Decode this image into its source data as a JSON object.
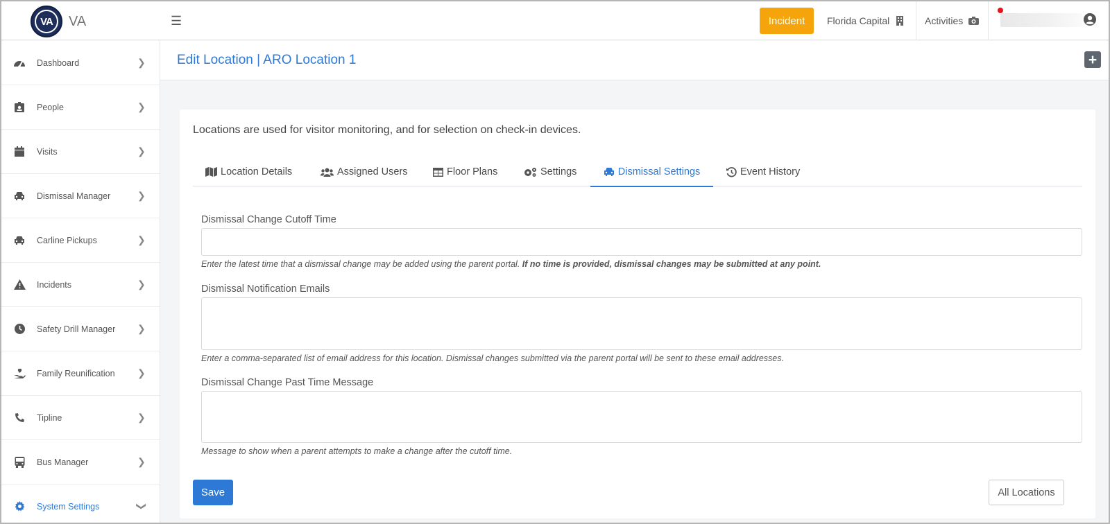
{
  "app": {
    "logo_text": "VA",
    "logo_initials": "VA"
  },
  "topbar": {
    "incident_label": "Incident",
    "location_label": "Florida Capital",
    "activities_label": "Activities"
  },
  "sidebar": {
    "items": [
      {
        "label": "Dashboard",
        "icon": "gauge-icon"
      },
      {
        "label": "People",
        "icon": "id-badge-icon"
      },
      {
        "label": "Visits",
        "icon": "calendar-icon"
      },
      {
        "label": "Dismissal Manager",
        "icon": "car-icon"
      },
      {
        "label": "Carline Pickups",
        "icon": "car-icon"
      },
      {
        "label": "Incidents",
        "icon": "warning-icon"
      },
      {
        "label": "Safety Drill Manager",
        "icon": "clock-icon"
      },
      {
        "label": "Family Reunification",
        "icon": "hand-heart-icon"
      },
      {
        "label": "Tipline",
        "icon": "phone-icon"
      },
      {
        "label": "Bus Manager",
        "icon": "bus-icon"
      },
      {
        "label": "System Settings",
        "icon": "gear-icon",
        "active": true
      }
    ]
  },
  "page": {
    "title": "Edit Location | ARO Location 1",
    "intro": "Locations are used for visitor monitoring, and for selection on check-in devices."
  },
  "tabs": [
    {
      "label": "Location Details",
      "icon": "map-icon"
    },
    {
      "label": "Assigned Users",
      "icon": "users-icon"
    },
    {
      "label": "Floor Plans",
      "icon": "table-icon"
    },
    {
      "label": "Settings",
      "icon": "gears-icon"
    },
    {
      "label": "Dismissal Settings",
      "icon": "car-icon",
      "active": true
    },
    {
      "label": "Event History",
      "icon": "history-icon"
    }
  ],
  "form": {
    "cutoff": {
      "label": "Dismissal Change Cutoff Time",
      "value": "",
      "help": "Enter the latest time that a dismissal change may be added using the parent portal.",
      "help_bold": "If no time is provided, dismissal changes may be submitted at any point."
    },
    "emails": {
      "label": "Dismissal Notification Emails",
      "value": "",
      "help": "Enter a comma-separated list of email address for this location. Dismissal changes submitted via the parent portal will be sent to these email addresses."
    },
    "past_message": {
      "label": "Dismissal Change Past Time Message",
      "value": "",
      "help": "Message to show when a parent attempts to make a change after the cutoff time."
    },
    "save_label": "Save",
    "all_locations_label": "All Locations"
  },
  "colors": {
    "accent": "#2e79d6",
    "incident": "#f5a40c",
    "logo": "#1d2e5b",
    "notification_dot": "#e8121b"
  }
}
